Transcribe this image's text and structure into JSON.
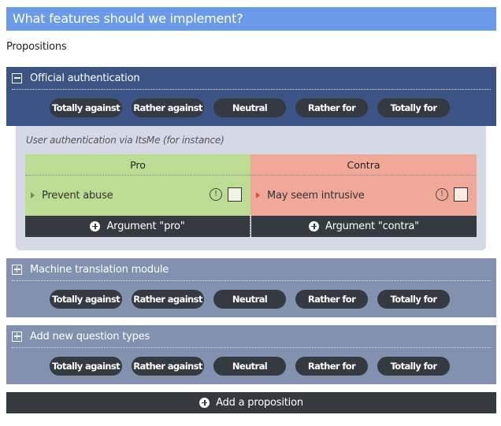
{
  "page": {
    "title": "What features should we implement?",
    "section_label": "Propositions"
  },
  "vote_options": [
    "Totally against",
    "Rather against",
    "Neutral",
    "Rather for",
    "Totally for"
  ],
  "propositions": [
    {
      "title": "Official authentication",
      "state": "expanded",
      "toggle_icon": "minus-square-icon",
      "description": "User authentication via ItsMe (for instance)",
      "pro": {
        "header": "Pro",
        "arguments": [
          {
            "text": "Prevent abuse",
            "checked": false
          }
        ],
        "add_label": "Argument \"pro\""
      },
      "contra": {
        "header": "Contra",
        "arguments": [
          {
            "text": "May seem intrusive",
            "checked": false
          }
        ],
        "add_label": "Argument \"contra\""
      }
    },
    {
      "title": "Machine translation module",
      "state": "collapsed",
      "toggle_icon": "plus-square-icon"
    },
    {
      "title": "Add new question types",
      "state": "collapsed",
      "toggle_icon": "plus-square-icon"
    }
  ],
  "add_proposition_label": "Add a proposition",
  "icons": {
    "warning": "!",
    "colors": {
      "title_bar": "#6b9be6",
      "expanded_header": "#3c5385",
      "collapsed_header": "#8291b0",
      "button_dark": "#343a40",
      "pro": "#bcdc94",
      "contra": "#f0a898",
      "detail_bg": "#d5d9e5"
    }
  }
}
